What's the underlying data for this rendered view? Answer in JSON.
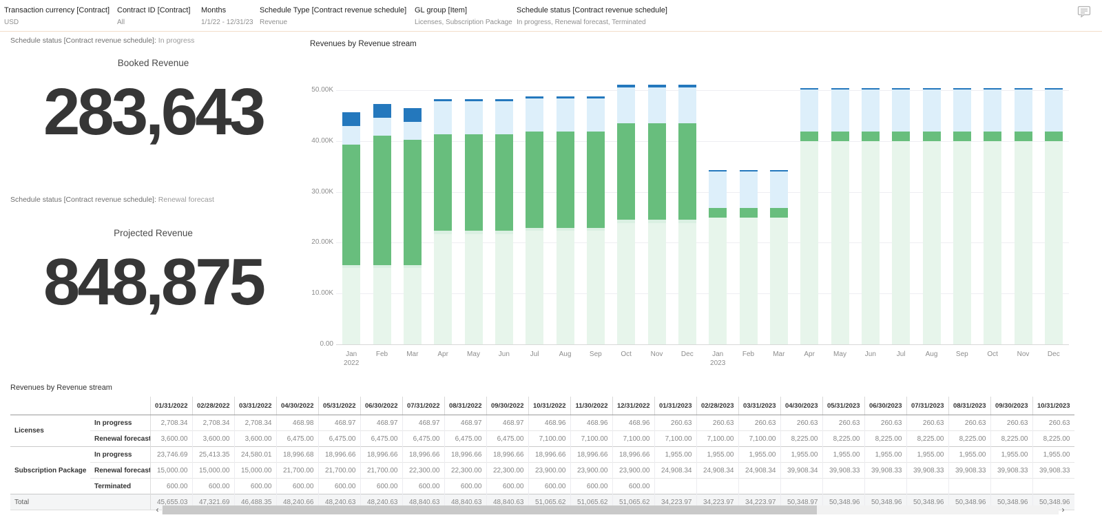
{
  "header": {
    "filters": [
      {
        "label": "Transaction currency [Contract]",
        "value": "USD",
        "x": 6
      },
      {
        "label": "Contract ID [Contract]",
        "value": "All",
        "x": 170
      },
      {
        "label": "Months",
        "value": "1/1/22 - 12/31/23",
        "x": 292
      },
      {
        "label": "Schedule Type [Contract revenue schedule]",
        "value": "Revenue",
        "x": 377
      },
      {
        "label": "GL group [Item]",
        "value": "Licenses, Subscription Package",
        "x": 602
      },
      {
        "label": "Schedule status [Contract revenue schedule]",
        "value": "In progress, Renewal forecast, Terminated",
        "x": 750
      }
    ],
    "comment_icon": "comment-icon"
  },
  "kpis": [
    {
      "context_label": "Schedule status [Contract revenue schedule]:",
      "context_value": " In progress",
      "title": "Booked Revenue",
      "value": "283,643"
    },
    {
      "context_label": "Schedule status [Contract revenue schedule]:",
      "context_value": " Renewal forecast",
      "title": "Projected Revenue",
      "value": "848,875"
    }
  ],
  "chart_data": {
    "type": "bar",
    "stacked": true,
    "title": "Revenues by Revenue stream",
    "legend_position": "none",
    "grid": true,
    "ylim": [
      0,
      50000
    ],
    "yticks": [
      "0.00",
      "10.00K",
      "20.00K",
      "30.00K",
      "40.00K",
      "50.00K"
    ],
    "months": [
      {
        "m": "Jan",
        "yr": "2022"
      },
      {
        "m": "Feb"
      },
      {
        "m": "Mar"
      },
      {
        "m": "Apr"
      },
      {
        "m": "May"
      },
      {
        "m": "Jun"
      },
      {
        "m": "Jul"
      },
      {
        "m": "Aug"
      },
      {
        "m": "Sep"
      },
      {
        "m": "Oct"
      },
      {
        "m": "Nov"
      },
      {
        "m": "Dec"
      },
      {
        "m": "Jan",
        "yr": "2023"
      },
      {
        "m": "Feb"
      },
      {
        "m": "Mar"
      },
      {
        "m": "Apr"
      },
      {
        "m": "May"
      },
      {
        "m": "Jun"
      },
      {
        "m": "Jul"
      },
      {
        "m": "Aug"
      },
      {
        "m": "Sep"
      },
      {
        "m": "Oct"
      },
      {
        "m": "Nov"
      },
      {
        "m": "Dec"
      }
    ],
    "series": [
      {
        "name": "Subscription Package - Renewal forecast",
        "color": "#e7f5eb",
        "values": [
          15000,
          15000,
          15000,
          21700,
          21700,
          21700,
          22300,
          22300,
          22300,
          23900,
          23900,
          23900,
          24908.34,
          24908.34,
          24908.34,
          39908.34,
          39908.33,
          39908.33,
          39908.33,
          39908.33,
          39908.33,
          39908.33,
          39908.33,
          39908.33
        ]
      },
      {
        "name": "Subscription Package - Terminated",
        "color": "#daf0e2",
        "values": [
          600,
          600,
          600,
          600,
          600,
          600,
          600,
          600,
          600,
          600,
          600,
          600,
          0,
          0,
          0,
          0,
          0,
          0,
          0,
          0,
          0,
          0,
          0,
          0
        ]
      },
      {
        "name": "Subscription Package - In progress",
        "color": "#68be7d",
        "values": [
          23746.69,
          25413.35,
          24580.01,
          18996.68,
          18996.66,
          18996.66,
          18996.66,
          18996.66,
          18996.66,
          18996.66,
          18996.66,
          18996.66,
          1955,
          1955,
          1955,
          1955,
          1955,
          1955,
          1955,
          1955,
          1955,
          1955,
          1955,
          1955
        ]
      },
      {
        "name": "Licenses - Renewal forecast",
        "color": "#ddeffa",
        "values": [
          3600,
          3600,
          3600,
          6475,
          6475,
          6475,
          6475,
          6475,
          6475,
          7100,
          7100,
          7100,
          7100,
          7100,
          7100,
          8225,
          8225,
          8225,
          8225,
          8225,
          8225,
          8225,
          8225,
          8225
        ]
      },
      {
        "name": "Licenses - In progress",
        "color": "#2478bd",
        "values": [
          2708.34,
          2708.34,
          2708.34,
          468.98,
          468.97,
          468.97,
          468.97,
          468.97,
          468.97,
          468.96,
          468.96,
          468.96,
          260.63,
          260.63,
          260.63,
          260.63,
          260.63,
          260.63,
          260.63,
          260.63,
          260.63,
          260.63,
          260.63,
          260.63
        ]
      }
    ]
  },
  "table": {
    "title": "Revenues by Revenue stream",
    "columns": [
      "01/31/2022",
      "02/28/2022",
      "03/31/2022",
      "04/30/2022",
      "05/31/2022",
      "06/30/2022",
      "07/31/2022",
      "08/31/2022",
      "09/30/2022",
      "10/31/2022",
      "11/30/2022",
      "12/31/2022",
      "01/31/2023",
      "02/28/2023",
      "03/31/2023",
      "04/30/2023",
      "05/31/2023",
      "06/30/2023",
      "07/31/2023",
      "08/31/2023",
      "09/30/2023",
      "10/31/2023"
    ],
    "groups": [
      {
        "stream": "Licenses",
        "rows": [
          {
            "status": "In progress",
            "values": [
              "2,708.34",
              "2,708.34",
              "2,708.34",
              "468.98",
              "468.97",
              "468.97",
              "468.97",
              "468.97",
              "468.97",
              "468.96",
              "468.96",
              "468.96",
              "260.63",
              "260.63",
              "260.63",
              "260.63",
              "260.63",
              "260.63",
              "260.63",
              "260.63",
              "260.63",
              "260.63"
            ]
          },
          {
            "status": "Renewal forecast",
            "values": [
              "3,600.00",
              "3,600.00",
              "3,600.00",
              "6,475.00",
              "6,475.00",
              "6,475.00",
              "6,475.00",
              "6,475.00",
              "6,475.00",
              "7,100.00",
              "7,100.00",
              "7,100.00",
              "7,100.00",
              "7,100.00",
              "7,100.00",
              "8,225.00",
              "8,225.00",
              "8,225.00",
              "8,225.00",
              "8,225.00",
              "8,225.00",
              "8,225.00"
            ]
          }
        ]
      },
      {
        "stream": "Subscription Package",
        "rows": [
          {
            "status": "In progress",
            "values": [
              "23,746.69",
              "25,413.35",
              "24,580.01",
              "18,996.68",
              "18,996.66",
              "18,996.66",
              "18,996.66",
              "18,996.66",
              "18,996.66",
              "18,996.66",
              "18,996.66",
              "18,996.66",
              "1,955.00",
              "1,955.00",
              "1,955.00",
              "1,955.00",
              "1,955.00",
              "1,955.00",
              "1,955.00",
              "1,955.00",
              "1,955.00",
              "1,955.00"
            ]
          },
          {
            "status": "Renewal forecast",
            "values": [
              "15,000.00",
              "15,000.00",
              "15,000.00",
              "21,700.00",
              "21,700.00",
              "21,700.00",
              "22,300.00",
              "22,300.00",
              "22,300.00",
              "23,900.00",
              "23,900.00",
              "23,900.00",
              "24,908.34",
              "24,908.34",
              "24,908.34",
              "39,908.34",
              "39,908.33",
              "39,908.33",
              "39,908.33",
              "39,908.33",
              "39,908.33",
              "39,908.33"
            ]
          },
          {
            "status": "Terminated",
            "values": [
              "600.00",
              "600.00",
              "600.00",
              "600.00",
              "600.00",
              "600.00",
              "600.00",
              "600.00",
              "600.00",
              "600.00",
              "600.00",
              "600.00",
              "",
              "",
              "",
              "",
              "",
              "",
              "",
              "",
              "",
              ""
            ]
          }
        ]
      }
    ],
    "total": {
      "label": "Total",
      "values": [
        "45,655.03",
        "47,321.69",
        "46,488.35",
        "48,240.66",
        "48,240.63",
        "48,240.63",
        "48,840.63",
        "48,840.63",
        "48,840.63",
        "51,065.62",
        "51,065.62",
        "51,065.62",
        "34,223.97",
        "34,223.97",
        "34,223.97",
        "50,348.97",
        "50,348.96",
        "50,348.96",
        "50,348.96",
        "50,348.96",
        "50,348.96",
        "50,348.96"
      ]
    }
  },
  "scrollbar": {
    "left_arrow": "‹",
    "right_arrow": "›"
  }
}
